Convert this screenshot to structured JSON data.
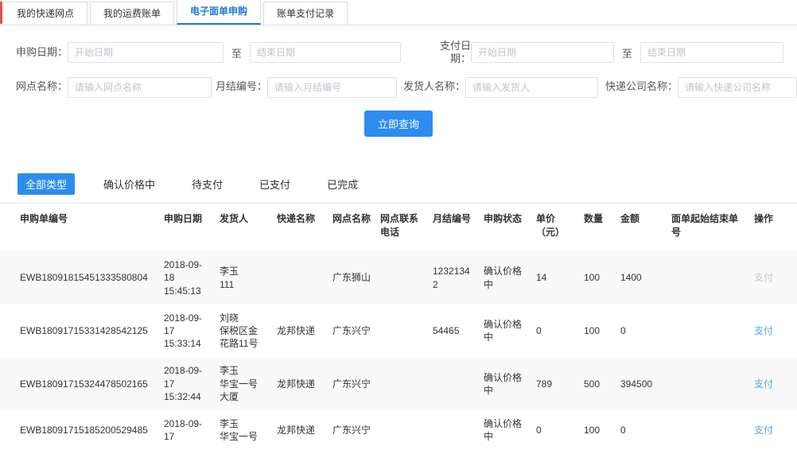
{
  "colors": {
    "accent": "#2d8cf0",
    "active_tab_text": "#1f7bd9",
    "pay_link": "#57a3f3",
    "pay_link_disabled": "#c9c9c9",
    "left_accent": "#d9534f"
  },
  "tabs": [
    {
      "label": "我的快递网点",
      "active": false
    },
    {
      "label": "我的运费账单",
      "active": false
    },
    {
      "label": "电子面单申购",
      "active": true
    },
    {
      "label": "账单支付记录",
      "active": false
    }
  ],
  "filters": {
    "purchase_date_label": "申购日期：",
    "pay_date_label": "支付日期：",
    "to_label": "至",
    "start_placeholder": "开始日期",
    "end_placeholder": "结束日期",
    "site_label": "网点名称：",
    "site_placeholder": "请输入网点名称",
    "monthly_label": "月结编号：",
    "monthly_placeholder": "请输入月结编号",
    "sender_label": "发货人名称：",
    "sender_placeholder": "请输入发货人",
    "courier_label": "快递公司名称：",
    "courier_placeholder": "请输入快递公司名称",
    "search_button": "立即查询"
  },
  "status_tabs": [
    {
      "label": "全部类型",
      "active": true
    },
    {
      "label": "确认价格中",
      "active": false
    },
    {
      "label": "待支付",
      "active": false
    },
    {
      "label": "已支付",
      "active": false
    },
    {
      "label": "已完成",
      "active": false
    }
  ],
  "table": {
    "headers": [
      "申购单编号",
      "申购日期",
      "发货人",
      "快递名称",
      "网点名称",
      "网点联系电话",
      "月结编号",
      "申购状态",
      "单价（元）",
      "数量",
      "金额",
      "面单起始结束单号",
      "操作"
    ],
    "action_label": "支付",
    "rows": [
      {
        "order_no": "EWB18091815451333580804",
        "date": "2018-09-18 15:45:13",
        "sender": "李玉\n111",
        "courier": "",
        "site": "广东狮山",
        "phone": "",
        "monthly_no": "12321342",
        "status": "确认价格中",
        "price": "14",
        "qty": "100",
        "amount": "1400",
        "range": "",
        "pay_enabled": false
      },
      {
        "order_no": "EWB18091715331428542125",
        "date": "2018-09-17 15:33:14",
        "sender": "刘晓\n保税区金\n花路11号",
        "courier": "龙邦快递",
        "site": "广东兴宁",
        "phone": "",
        "monthly_no": "54465",
        "status": "确认价格中",
        "price": "0",
        "qty": "100",
        "amount": "0",
        "range": "",
        "pay_enabled": true
      },
      {
        "order_no": "EWB18091715324478502165",
        "date": "2018-09-17 15:32:44",
        "sender": "李玉\n华宝一号\n大厦",
        "courier": "龙邦快递",
        "site": "广东兴宁",
        "phone": "",
        "monthly_no": "",
        "status": "确认价格中",
        "price": "789",
        "qty": "500",
        "amount": "394500",
        "range": "",
        "pay_enabled": true
      },
      {
        "order_no": "EWB18091715185200529485",
        "date": "2018-09-17",
        "sender": "李玉\n华宝一号",
        "courier": "龙邦快递",
        "site": "广东兴宁",
        "phone": "",
        "monthly_no": "",
        "status": "确认价格中",
        "price": "0",
        "qty": "100",
        "amount": "0",
        "range": "",
        "pay_enabled": true
      }
    ]
  }
}
